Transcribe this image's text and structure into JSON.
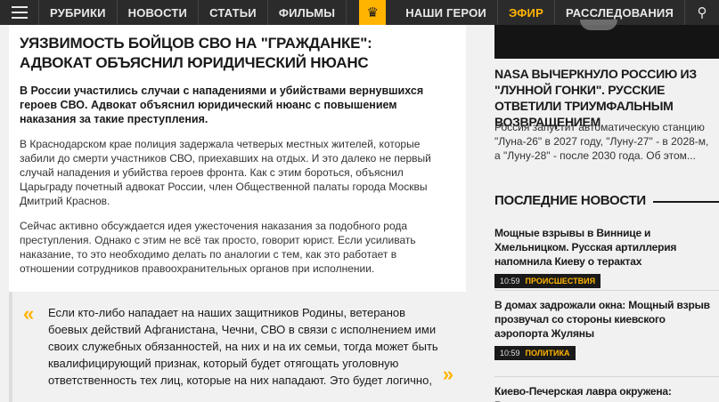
{
  "nav": {
    "items": [
      "РУБРИКИ",
      "НОВОСТИ",
      "СТАТЬИ",
      "ФИЛЬМЫ"
    ],
    "emblem_icon": "double-headed-eagle-icon",
    "right_items": [
      "НАШИ ГЕРОИ",
      "ЭФИР",
      "РАССЛЕДОВАНИЯ"
    ],
    "search_icon": "search-icon",
    "accent_color": "#ffb400"
  },
  "article": {
    "headline": "УЯЗВИМОСТЬ БОЙЦОВ СВО НА \"ГРАЖДАНКЕ\": АДВОКАТ ОБЪЯСНИЛ ЮРИДИЧЕСКИЙ НЮАНС",
    "lead": "В России участились случаи с нападениями и убийствами вернувшихся героев СВО. Адвокат объяснил юридический нюанс с повышением наказания за такие преступления.",
    "paragraphs": [
      "В Краснодарском крае полиция задержала четверых местных жителей, которые забили до смерти участников СВО, приехавших на отдых. И это далеко не первый случай нападения и убийства героев фронта. Как с этим бороться, объяснил Царьграду почетный адвокат России, член Общественной палаты города Москвы Дмитрий Краснов.",
      "Сейчас активно обсуждается идея ужесточения наказания за подобного рода преступления. Однако с этим не всё так просто, говорит юрист. Если усиливать наказание, то это необходимо делать по аналогии с тем, как это работает в отношении сотрудников правоохранительных органов при исполнении."
    ],
    "quote": "Если кто-либо нападает на наших защитников Родины, ветеранов боевых действий Афганистана, Чечни, СВО в связи с исполнением ими своих служебных обязанностей, на них и на их семьи, тогда может быть квалифицирующий признак, который будет отягощать уголовную ответственность тех лиц, которые на них нападают. Это будет логично,"
  },
  "sidebar": {
    "featured_title": "NASA ВЫЧЕРКНУЛО РОССИЮ ИЗ \"ЛУННОЙ ГОНКИ\". РУССКИЕ ОТВЕТИЛИ ТРИУМФАЛЬНЫМ ВОЗВРАЩЕНИЕМ",
    "featured_desc": "Россия запустит автоматическую станцию \"Луна-26\" в 2027 году, \"Луну-27\" - в 2028-м, а \"Луну-28\" - после 2030 года. Об этом...",
    "latest_heading": "ПОСЛЕДНИЕ НОВОСТИ",
    "news": [
      {
        "title": "Мощные взрывы в Виннице и Хмельницком. Русская артиллерия напомнила Киеву о терактах",
        "time": "10:59",
        "category": "ПРОИСШЕСТВИЯ"
      },
      {
        "title": "В домах задрожали окна: Мощный взрыв прозвучал со стороны киевского аэропорта Жуляны",
        "time": "10:59",
        "category": "ПОЛИТИКА"
      },
      {
        "title": "Киево-Печерская лавра окружена: Верующих",
        "time": "",
        "category": ""
      }
    ]
  }
}
